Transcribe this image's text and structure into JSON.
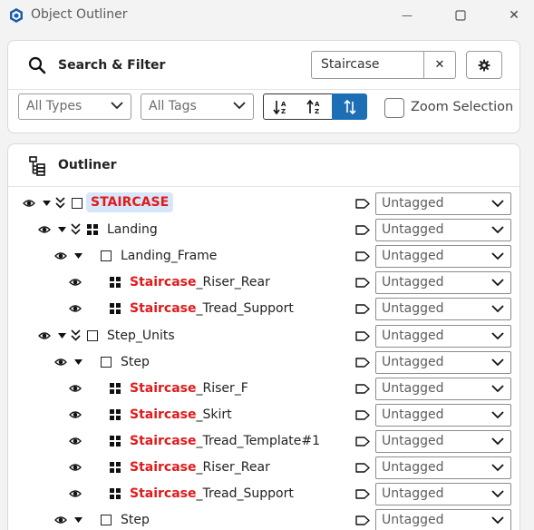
{
  "window": {
    "title": "Object Outliner",
    "minimize_glyph": "—",
    "close_glyph": "✕"
  },
  "search_filter": {
    "title": "Search & Filter",
    "search_value": "Staircase",
    "clear_glyph": "✕",
    "type_filter": "All Types",
    "tag_filter": "All Tags",
    "zoom_selection_label": "Zoom Selection",
    "zoom_selection_checked": false,
    "sort_buttons": [
      "sort-a-z-icon",
      "sort-z-a-icon",
      "sort-ordered-icon"
    ],
    "active_sort": 2
  },
  "outliner": {
    "title": "Outliner",
    "tree": [
      {
        "level": 0,
        "type": "group",
        "expander": "double",
        "match": "STAIRCASE",
        "rest": "",
        "tag": "Untagged"
      },
      {
        "level": 1,
        "type": "component",
        "expander": "double",
        "match": "",
        "rest": "Landing",
        "tag": "Untagged"
      },
      {
        "level": 2,
        "type": "group",
        "expander": "single",
        "match": "",
        "rest": "Landing_Frame",
        "tag": "Untagged"
      },
      {
        "level": 3,
        "type": "component",
        "expander": "none",
        "match": "Staircase",
        "rest": "_Riser_Rear",
        "tag": "Untagged"
      },
      {
        "level": 3,
        "type": "component",
        "expander": "none",
        "match": "Staircase",
        "rest": "_Tread_Support",
        "tag": "Untagged"
      },
      {
        "level": 1,
        "type": "group",
        "expander": "double",
        "match": "",
        "rest": "Step_Units",
        "tag": "Untagged"
      },
      {
        "level": 2,
        "type": "group",
        "expander": "single",
        "match": "",
        "rest": "Step",
        "tag": "Untagged"
      },
      {
        "level": 3,
        "type": "component",
        "expander": "none",
        "match": "Staircase",
        "rest": "_Riser_F",
        "tag": "Untagged"
      },
      {
        "level": 3,
        "type": "component",
        "expander": "none",
        "match": "Staircase",
        "rest": "_Skirt",
        "tag": "Untagged"
      },
      {
        "level": 3,
        "type": "component",
        "expander": "none",
        "match": "Staircase",
        "rest": "_Tread_Template#1",
        "tag": "Untagged"
      },
      {
        "level": 3,
        "type": "component",
        "expander": "none",
        "match": "Staircase",
        "rest": "_Riser_Rear",
        "tag": "Untagged"
      },
      {
        "level": 3,
        "type": "component",
        "expander": "none",
        "match": "Staircase",
        "rest": "_Tread_Support",
        "tag": "Untagged"
      },
      {
        "level": 2,
        "type": "group",
        "expander": "single",
        "match": "",
        "rest": "Step",
        "tag": "Untagged"
      }
    ]
  },
  "colors": {
    "match_highlight": "#e01b1b",
    "active_sort": "#1c6fb5",
    "root_selection": "#d7e6f8"
  }
}
